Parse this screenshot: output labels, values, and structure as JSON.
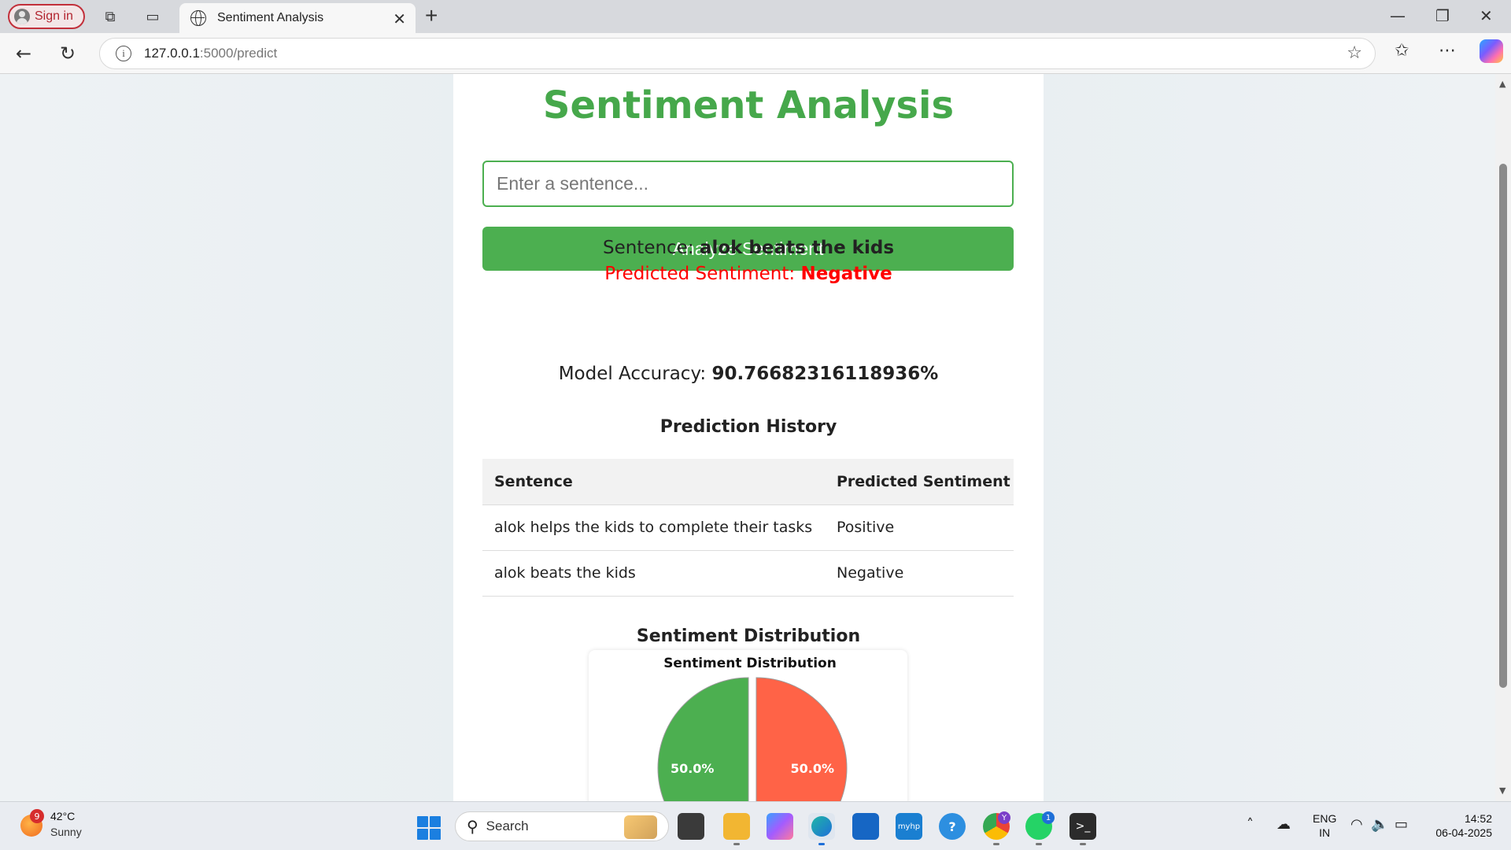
{
  "browser": {
    "signin_label": "Sign in",
    "tab_title": "Sentiment Analysis",
    "url_host": "127.0.0.1",
    "url_path": ":5000/predict"
  },
  "page": {
    "title": "Sentiment Analysis",
    "input_placeholder": "Enter a sentence...",
    "analyze_button": "Analyze Sentiment",
    "sentence_label": "Sentence: ",
    "sentence_value": "alok beats the kids",
    "predicted_label": "Predicted Sentiment: ",
    "predicted_value": "Negative",
    "accuracy_label": "Model Accuracy: ",
    "accuracy_value": "90.76682316118936%",
    "history_title": "Prediction History",
    "history_headers": [
      "Sentence",
      "Predicted Sentiment"
    ],
    "history_rows": [
      [
        "alok helps the kids to complete their tasks",
        "Positive"
      ],
      [
        "alok beats the kids",
        "Negative"
      ]
    ],
    "distribution_title": "Sentiment Distribution"
  },
  "chart_data": {
    "type": "pie",
    "title": "Sentiment Distribution",
    "slices": [
      {
        "label": "50.0%",
        "value": 50.0,
        "color": "#4caf50"
      },
      {
        "label": "50.0%",
        "value": 50.0,
        "color": "#ff6347"
      }
    ]
  },
  "taskbar": {
    "temp": "42°C",
    "condition": "Sunny",
    "weather_badge": "9",
    "search_label": "Search",
    "chrome_badge": "Y",
    "whatsapp_badge": "1",
    "lang_line1": "ENG",
    "lang_line2": "IN",
    "time": "14:52",
    "date": "06-04-2025"
  },
  "colors": {
    "accent": "#4caf50",
    "negative": "#ff0000",
    "pie_positive": "#4caf50",
    "pie_negative": "#ff6347"
  }
}
